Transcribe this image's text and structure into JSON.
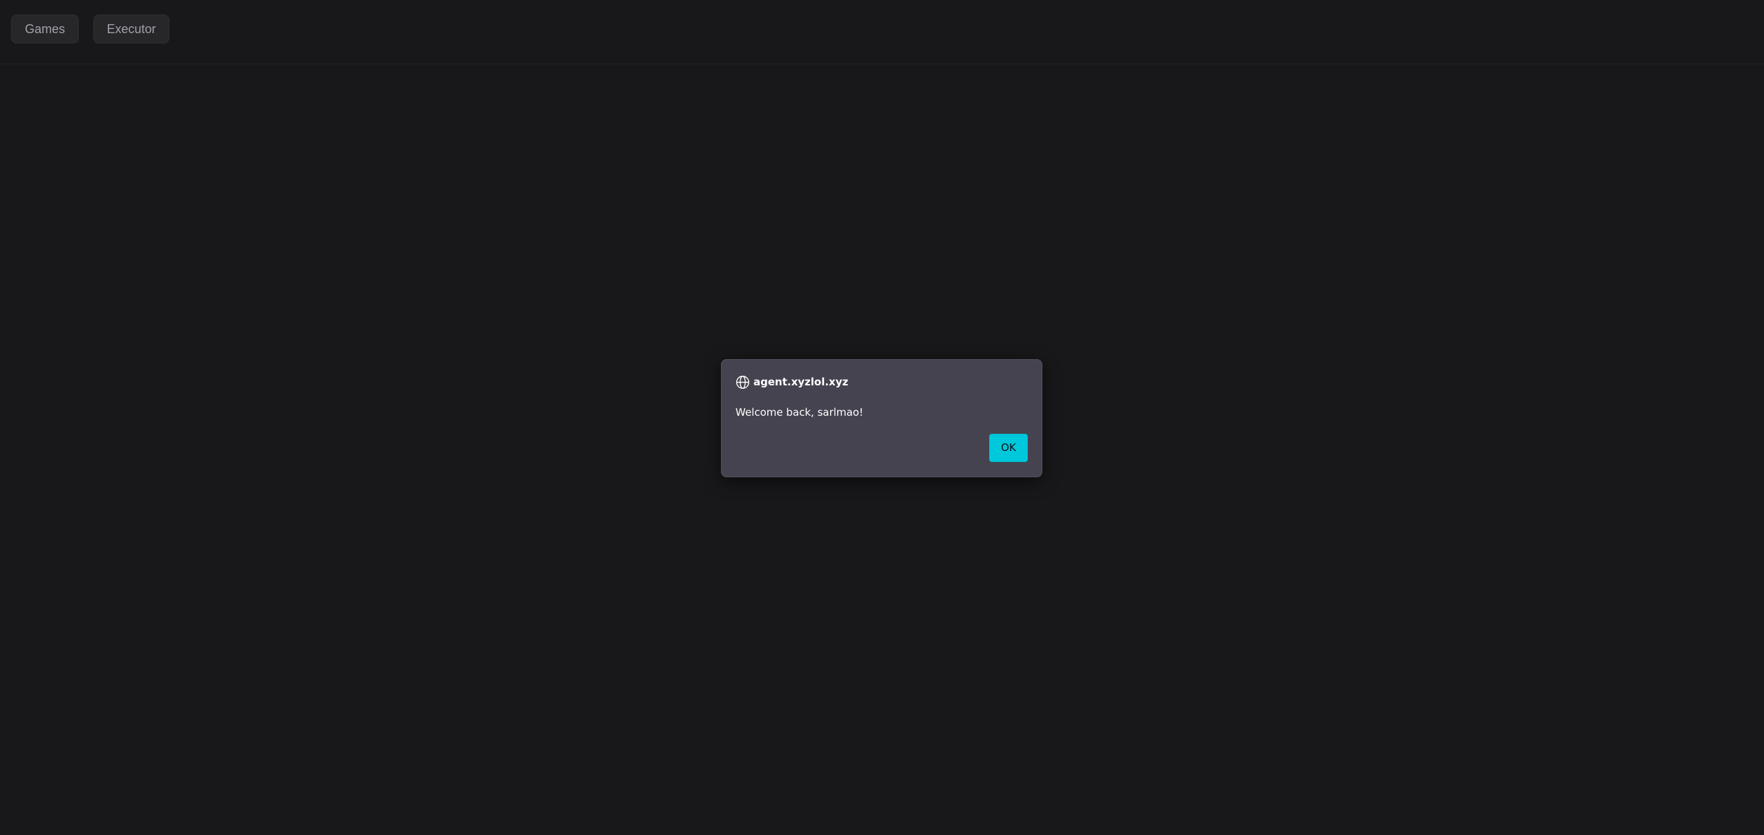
{
  "nav": {
    "buttons": [
      {
        "label": "Games"
      },
      {
        "label": "Executor"
      }
    ]
  },
  "dialog": {
    "icon": "globe-icon",
    "origin": "agent.xyzlol.xyz",
    "message": "Welcome back, sarlmao!",
    "ok_label": "OK"
  },
  "colors": {
    "background": "#18181a",
    "nav_button_bg": "#27272a",
    "nav_button_text": "#a1a1aa",
    "dialog_bg": "#45434f",
    "accent": "#00c8dc"
  }
}
